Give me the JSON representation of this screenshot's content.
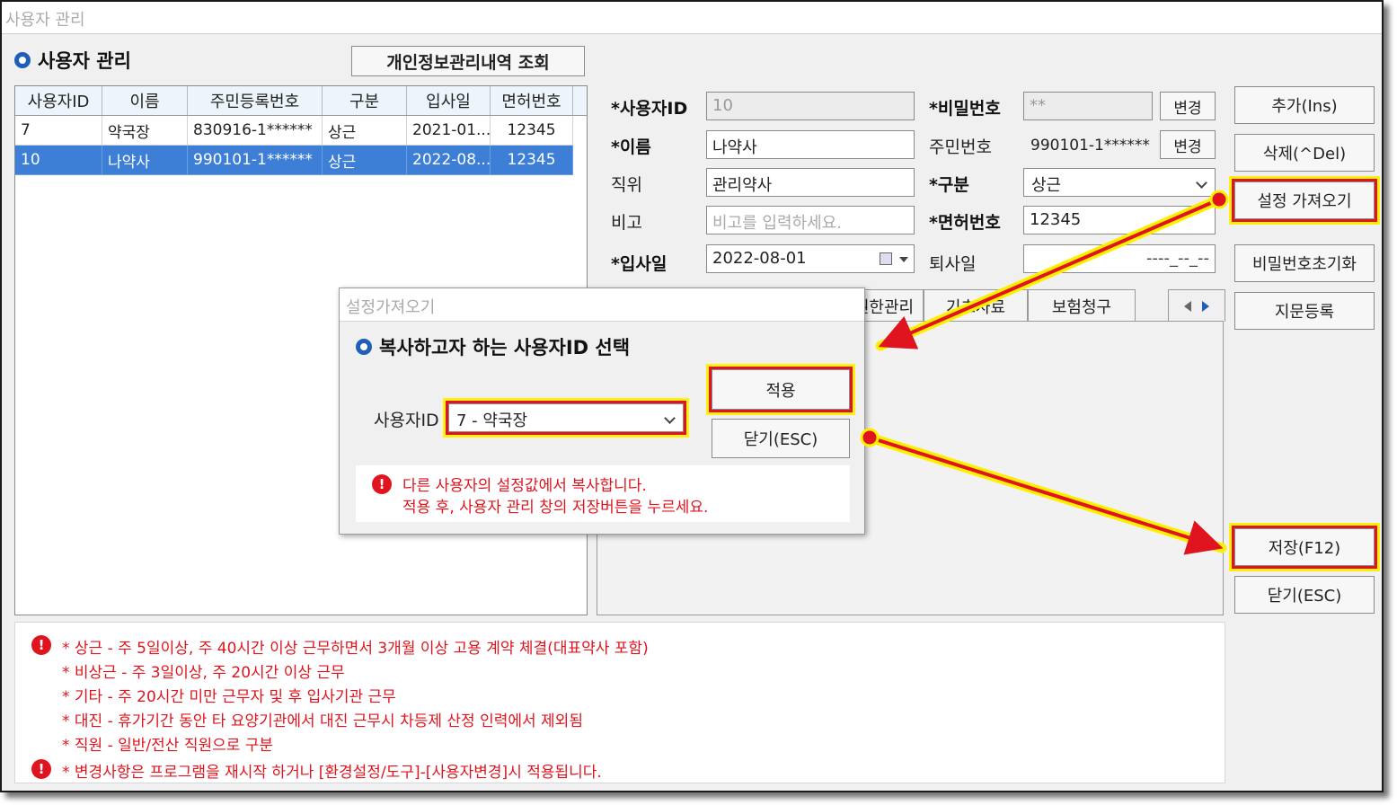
{
  "window": {
    "title": "사용자 관리"
  },
  "section_title": "사용자 관리",
  "privacy_button": "개인정보관리내역 조회",
  "grid": {
    "headers": [
      "사용자ID",
      "이름",
      "주민등록번호",
      "구분",
      "입사일",
      "면허번호"
    ],
    "rows": [
      [
        "7",
        "약국장",
        "830916-1******",
        "상근",
        "2021-01...",
        "12345"
      ],
      [
        "10",
        "나약사",
        "990101-1******",
        "상근",
        "2022-08...",
        "12345"
      ]
    ],
    "selected_row": 1
  },
  "form": {
    "user_id_label": "*사용자ID",
    "user_id": "10",
    "password_label": "*비밀번호",
    "password": "**",
    "password_change": "변경",
    "name_label": "*이름",
    "name": "나약사",
    "rrn_label": "주민번호",
    "rrn": "990101-1******",
    "rrn_change": "변경",
    "position_label": "직위",
    "position": "관리약사",
    "type_label": "*구분",
    "type": "상근",
    "memo_label": "비고",
    "memo_placeholder": "비고를 입력하세요.",
    "license_label": "*면허번호",
    "license": "12345",
    "join_label": "*입사일",
    "join_date": "2022-08-01",
    "leave_label": "퇴사일",
    "leave_date": "----_--_--"
  },
  "tabs": [
    "권한관리",
    "기초자료",
    "보험청구"
  ],
  "right_buttons": {
    "add": "추가(Ins)",
    "delete": "삭제(^Del)",
    "import_settings": "설정 가져오기",
    "reset_password": "비밀번호초기화",
    "fingerprint": "지문등록",
    "save": "저장(F12)",
    "close": "닫기(ESC)"
  },
  "dialog": {
    "title": "설정가져오기",
    "heading": "복사하고자 하는 사용자ID 선택",
    "user_id_label": "사용자ID",
    "user_select": "7 - 약국장",
    "apply": "적용",
    "close": "닫기(ESC)",
    "warning_line1": "다른 사용자의 설정값에서 복사합니다.",
    "warning_line2": "적용 후, 사용자 관리 창의 저장버튼을 누르세요."
  },
  "notes": [
    "* 상근    - 주 5일이상, 주 40시간 이상 근무하면서 3개월 이상 고용 계약 체결(대표약사 포함)",
    "* 비상근 - 주 3일이상, 주 20시간 이상 근무",
    "* 기타    - 주 20시간 미만 근무자 및 후 입사기관 근무",
    "* 대진    - 휴가기간 동안 타 요양기관에서 대진 근무시 차등제 산정 인력에서 제외됨",
    "* 직원    - 일반/전산 직원으로 구분",
    "* 변경사항은 프로그램을 재시작 하거나 [환경설정/도구]-[사용자변경]시 적용됩니다."
  ],
  "colors": {
    "accent": "#1f5fb8",
    "selected_row": "#3d7fd6",
    "warning": "#e0141e",
    "highlight": "#fff000"
  }
}
